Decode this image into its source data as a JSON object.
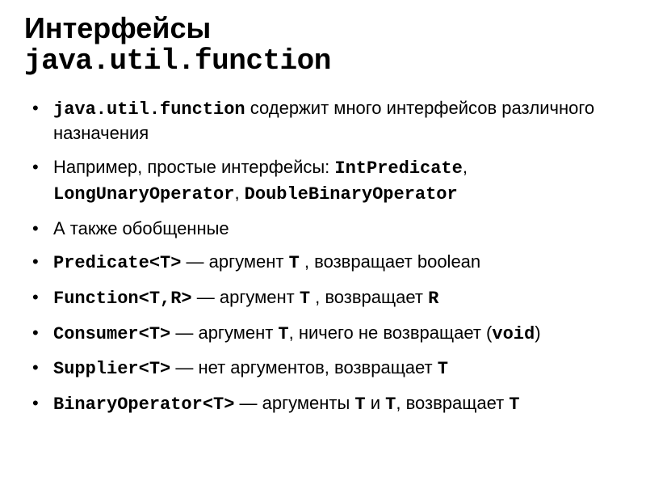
{
  "title": {
    "line1": "Интерфейсы",
    "line2": "java.util.function"
  },
  "items": {
    "b0": {
      "pkg": "java.util.function",
      "text_after": " содержит много интерфейсов различного назначения"
    },
    "b1": {
      "prefix": "Например, простые интерфейсы: ",
      "ex1": "IntPredicate",
      "sep1": ", ",
      "ex2": "LongUnaryOperator",
      "sep2": ", ",
      "ex3": "DoubleBinaryOperator"
    },
    "b2": {
      "text": "А также обобщенные"
    },
    "b3": {
      "type": "Predicate<T>",
      "mid1": " — аргумент ",
      "arg": "T",
      "mid2": " , возвращает boolean"
    },
    "b4": {
      "type": "Function<T,R>",
      "mid1": " — аргумент ",
      "arg": "T",
      "mid2": " , возвращает ",
      "ret": "R"
    },
    "b5": {
      "type": "Consumer<T>",
      "mid1": " — аргумент ",
      "arg": "T",
      "mid2": ", ничего не возвращает (",
      "void": "void",
      "close": ")"
    },
    "b6": {
      "type": "Supplier<T>",
      "mid1": " — нет аргументов, возвращает ",
      "ret": "T"
    },
    "b7": {
      "type": "BinaryOperator<T>",
      "mid1": " — аргументы ",
      "arg1": "T",
      "and": " и ",
      "arg2": "T",
      "mid2": ", возвращает ",
      "ret": "T"
    }
  }
}
